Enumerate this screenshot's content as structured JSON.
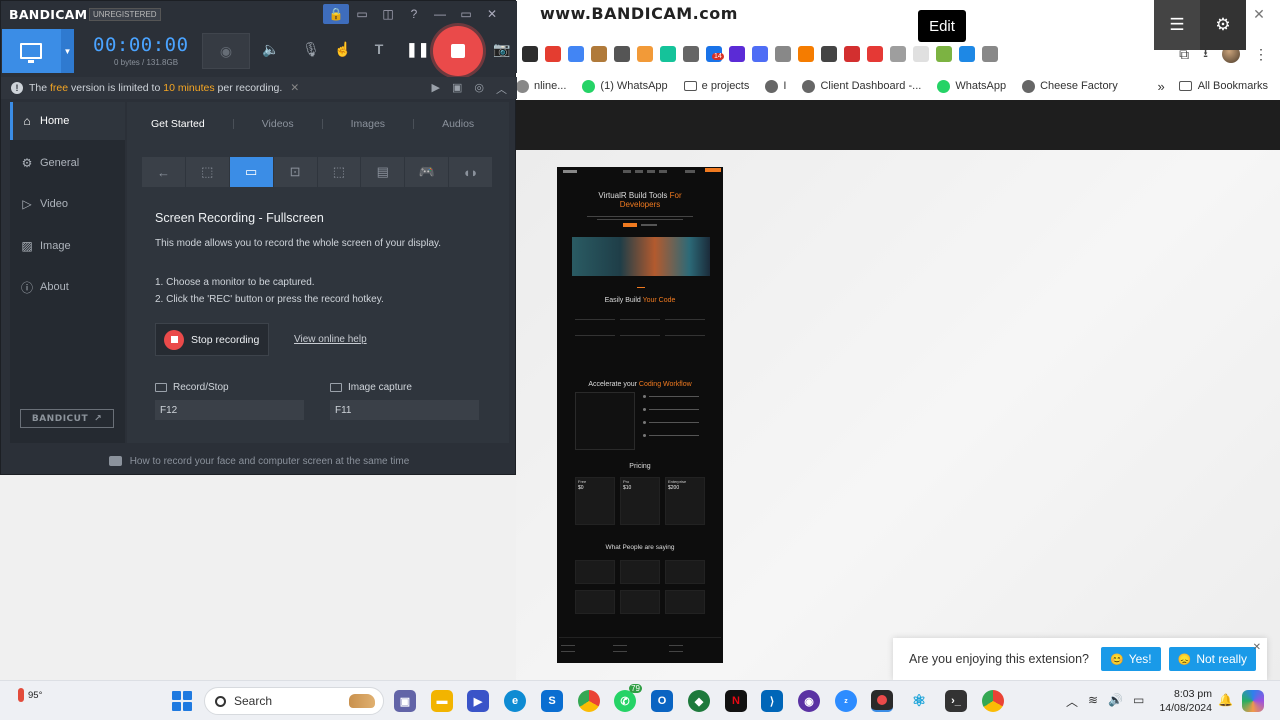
{
  "watermark": "www.BANDICAM.com",
  "browser": {
    "window_controls": [
      "—",
      "❐",
      "✕"
    ],
    "extensions": [
      {
        "name": "extension-dark-icon",
        "color": "#2d2d2d"
      },
      {
        "name": "extension-tp-icon",
        "color": "#e43d30"
      },
      {
        "name": "extension-translate-icon",
        "color": "#4285f4"
      },
      {
        "name": "extension-cookie-icon",
        "color": "#b07a3a"
      },
      {
        "name": "extension-mask-icon",
        "color": "#555555"
      },
      {
        "name": "extension-drop-icon",
        "color": "#f29a38"
      },
      {
        "name": "extension-grammarly-icon",
        "color": "#15c39a"
      },
      {
        "name": "extension-gauge-icon",
        "color": "#666666"
      },
      {
        "name": "extension-calendar-icon",
        "color": "#1a73e8",
        "badge": "14"
      },
      {
        "name": "extension-diamond-icon",
        "color": "#5b2bd6"
      },
      {
        "name": "extension-asterisk-icon",
        "color": "#4f6df5"
      },
      {
        "name": "extension-a-icon",
        "color": "#888888"
      },
      {
        "name": "extension-chart-icon",
        "color": "#f57c00"
      },
      {
        "name": "extension-m-icon",
        "color": "#444444"
      },
      {
        "name": "extension-pdf-icon",
        "color": "#d32f2f"
      },
      {
        "name": "extension-play-icon",
        "color": "#e53935"
      },
      {
        "name": "extension-camera-icon",
        "color": "#9e9e9e"
      },
      {
        "name": "extension-blank-icon",
        "color": "#e0e0e0"
      },
      {
        "name": "extension-green-icon",
        "color": "#7cb342"
      },
      {
        "name": "extension-c-icon",
        "color": "#1e88e5"
      },
      {
        "name": "extension-mail-icon",
        "color": "#888888"
      }
    ],
    "bookmarks": [
      {
        "label": "nline...",
        "icon": "globe",
        "color": "#888888"
      },
      {
        "label": "(1) WhatsApp",
        "icon": "whatsapp",
        "color": "#25d366"
      },
      {
        "label": "e projects",
        "icon": "folder",
        "color": "#555555"
      },
      {
        "label": "I",
        "icon": "globe",
        "color": "#666666"
      },
      {
        "label": "Client Dashboard -...",
        "icon": "globe",
        "color": "#666666"
      },
      {
        "label": "WhatsApp",
        "icon": "whatsapp",
        "color": "#25d366"
      },
      {
        "label": "Cheese Factory",
        "icon": "globe",
        "color": "#666666"
      }
    ],
    "bookmarks_more": "»",
    "all_bookmarks": "All Bookmarks",
    "toolbar": {
      "edit_label": "Edit"
    }
  },
  "preview": {
    "hero_title": "VirtualR Build Tools",
    "hero_title_accent_1": "For",
    "hero_title_accent_2": "Developers",
    "section1_title": "Easily Build",
    "section1_accent": "Your Code",
    "section2_title": "Accelerate your",
    "section2_accent": "Coding Workflow",
    "pricing_title": "Pricing",
    "pricing_plans": [
      {
        "name": "Free",
        "price": "$0"
      },
      {
        "name": "Pro",
        "price": "$10"
      },
      {
        "name": "Enterprise",
        "price": "$200"
      }
    ],
    "testimonials_title": "What People are saying",
    "accent_color": "#f07a20"
  },
  "toast": {
    "question": "Are you enjoying this extension?",
    "yes_label": "Yes!",
    "no_label": "Not really",
    "close": "✕",
    "button_color": "#1a9ae8"
  },
  "bandicam": {
    "logo": "BANDICAM",
    "unregistered": "UNREGISTERED",
    "timer": "00:00:00",
    "size": "0 bytes / 131.8GB",
    "notice_pre": "The",
    "notice_free": "free",
    "notice_mid": "version is limited to",
    "notice_limit": "10 minutes",
    "notice_post": "per recording.",
    "notice_close": "✕",
    "nav": [
      {
        "label": "Home",
        "icon": "home"
      },
      {
        "label": "General",
        "icon": "gear"
      },
      {
        "label": "Video",
        "icon": "video"
      },
      {
        "label": "Image",
        "icon": "image"
      },
      {
        "label": "About",
        "icon": "info"
      }
    ],
    "bandicut": "BANDICUT",
    "tabs": [
      "Get Started",
      "Videos",
      "Images",
      "Audios"
    ],
    "mode_title": "Screen Recording - Fullscreen",
    "mode_desc": "This mode allows you to record the whole screen of your display.",
    "step1": "1. Choose a monitor to be captured.",
    "step2": "2. Click the 'REC' button or press the record hotkey.",
    "stop_label": "Stop recording",
    "help_link": "View online help",
    "hotkeys": [
      {
        "label": "Record/Stop",
        "key": "F12"
      },
      {
        "label": "Image capture",
        "key": "F11"
      }
    ],
    "footer_tip": "How to record your face and computer screen at the same time",
    "accent_color": "#3b8de6",
    "rec_color": "#ea4a4a",
    "notice_highlight_color": "#f5a623"
  },
  "taskbar": {
    "temperature": "95°",
    "search_placeholder": "Search",
    "whatsapp_badge": "79",
    "time": "8:03 pm",
    "date": "14/08/2024"
  }
}
